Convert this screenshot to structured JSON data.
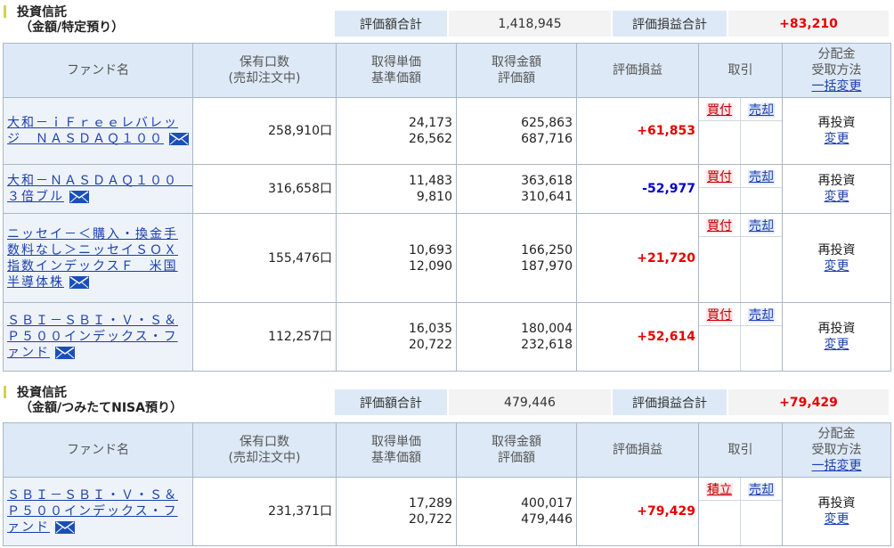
{
  "sections": [
    {
      "title_line1": "投資信託",
      "title_line2": "（金額/特定預り）",
      "summary": {
        "value_label": "評価額合計",
        "value": "1,418,945",
        "pl_label": "評価損益合計",
        "pl": "+83,210"
      },
      "headers": {
        "fund": "ファンド名",
        "units_1": "保有口数",
        "units_2": "(売却注文中)",
        "unit_1": "取得単価",
        "unit_2": "基準価額",
        "amount_1": "取得金額",
        "amount_2": "評価額",
        "pl": "評価損益",
        "trade": "取引",
        "dist_1": "分配金",
        "dist_2": "受取方法",
        "dist_link": "一括変更"
      },
      "rows": [
        {
          "name": "大和－ｉＦｒｅｅレバレッジ　ＮＡＳＤＡＱ１００",
          "units": "258,910口",
          "cost_price": "24,173",
          "base_price": "26,562",
          "cost_amount": "625,863",
          "value": "687,716",
          "pl": "+61,853",
          "buy": "買付",
          "sell": "売却",
          "dist": "再投資",
          "change": "変更"
        },
        {
          "name": "大和－ＮＡＳＤＡＱ１００　３倍ブル",
          "units": "316,658口",
          "cost_price": "11,483",
          "base_price": "9,810",
          "cost_amount": "363,618",
          "value": "310,641",
          "pl": "-52,977",
          "buy": "買付",
          "sell": "売却",
          "dist": "再投資",
          "change": "変更"
        },
        {
          "name": "ニッセイ－＜購入・換金手数料なし＞ニッセイＳＯＸ指数インデックスＦ　米国半導体株",
          "units": "155,476口",
          "cost_price": "10,693",
          "base_price": "12,090",
          "cost_amount": "166,250",
          "value": "187,970",
          "pl": "+21,720",
          "buy": "買付",
          "sell": "売却",
          "dist": "再投資",
          "change": "変更"
        },
        {
          "name": "ＳＢＩ－ＳＢＩ・Ｖ・Ｓ＆Ｐ５００インデックス・ファンド",
          "units": "112,257口",
          "cost_price": "16,035",
          "base_price": "20,722",
          "cost_amount": "180,004",
          "value": "232,618",
          "pl": "+52,614",
          "buy": "買付",
          "sell": "売却",
          "dist": "再投資",
          "change": "変更"
        }
      ]
    },
    {
      "title_line1": "投資信託",
      "title_line2": "（金額/つみたてNISA預り）",
      "summary": {
        "value_label": "評価額合計",
        "value": "479,446",
        "pl_label": "評価損益合計",
        "pl": "+79,429"
      },
      "headers": {
        "fund": "ファンド名",
        "units_1": "保有口数",
        "units_2": "(売却注文中)",
        "unit_1": "取得単価",
        "unit_2": "基準価額",
        "amount_1": "取得金額",
        "amount_2": "評価額",
        "pl": "評価損益",
        "trade": "取引",
        "dist_1": "分配金",
        "dist_2": "受取方法",
        "dist_link": "一括変更"
      },
      "rows": [
        {
          "name": "ＳＢＩ－ＳＢＩ・Ｖ・Ｓ＆Ｐ５００インデックス・ファンド",
          "units": "231,371口",
          "cost_price": "17,289",
          "base_price": "20,722",
          "cost_amount": "400,017",
          "value": "479,446",
          "pl": "+79,429",
          "buy": "積立",
          "sell": "売却",
          "dist": "再投資",
          "change": "変更"
        }
      ]
    }
  ],
  "colors": {
    "header_bg": "#dde9f6",
    "positive": "#e60000",
    "negative": "#0000cc",
    "link": "#1a3fae"
  },
  "icons": {
    "mail": "envelope-icon"
  }
}
